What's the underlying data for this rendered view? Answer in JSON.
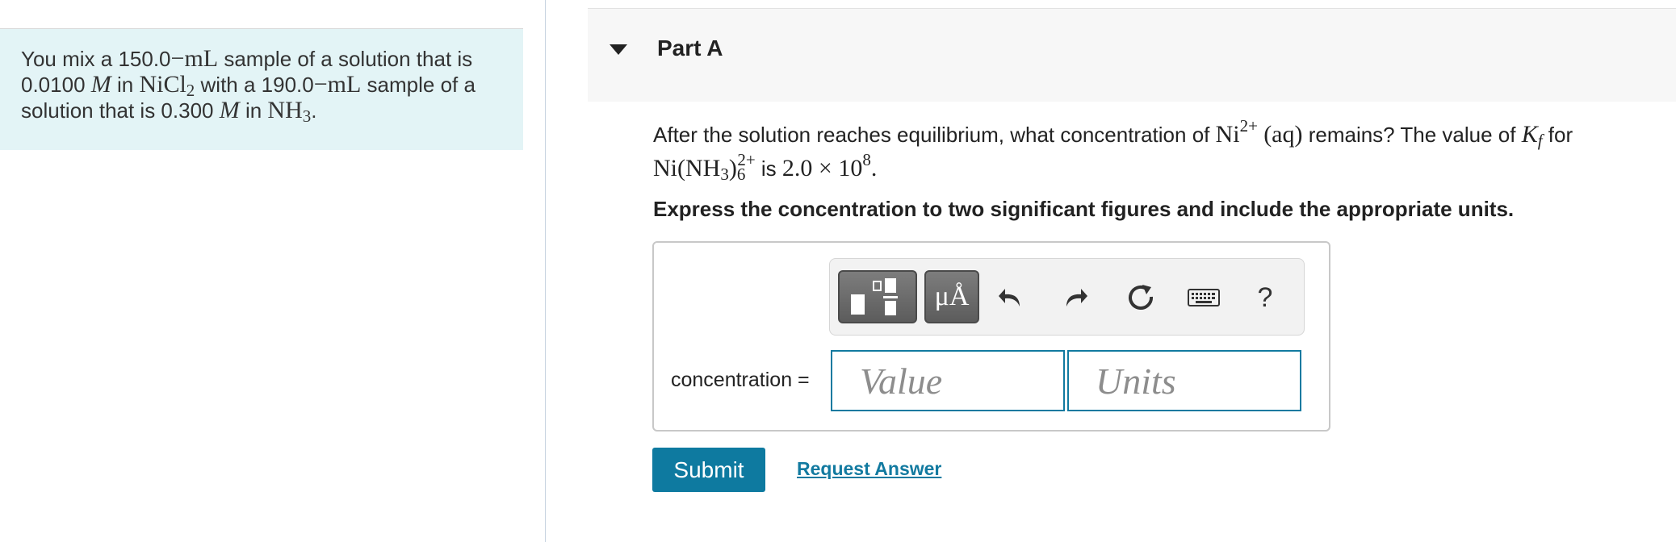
{
  "problem": {
    "t1": "You mix a 150.0",
    "dash1": "−",
    "unit1": "mL",
    "t2": " sample of a solution that is",
    "t3": "0.0100 ",
    "molar1": "M",
    "t4": " in ",
    "nicl_base": "NiCl",
    "nicl_sub": "2",
    "t5": " with a 190.0",
    "dash2": "−",
    "unit2": "mL",
    "t6": " sample of a",
    "t7": "solution that is 0.300 ",
    "molar2": "M",
    "t8": " in ",
    "nh_base": "NH",
    "nh_sub": "3",
    "t9": "."
  },
  "part": {
    "title": "Part A"
  },
  "question": {
    "t1": "After the solution reaches equilibrium, what concentration of ",
    "ni": "Ni",
    "ni_charge": "2+",
    "aq": "(aq)",
    "t2": " remains? The value of ",
    "k": "K",
    "k_sub": "f",
    "t3": " for",
    "complex_open": "Ni(NH",
    "complex_sub3": "3",
    "complex_close": ")",
    "complex_sub6": "6",
    "complex_charge": "2+",
    "t4": " is ",
    "value": "2.0 × 10",
    "exp": "8",
    "period": "."
  },
  "instruction": "Express the concentration to two significant figures and include the appropriate units.",
  "toolbar": {
    "units_label": "μÅ",
    "help_label": "?"
  },
  "answer": {
    "label": "concentration =",
    "value_placeholder": "Value",
    "units_placeholder": "Units"
  },
  "actions": {
    "submit": "Submit",
    "request": "Request Answer"
  }
}
